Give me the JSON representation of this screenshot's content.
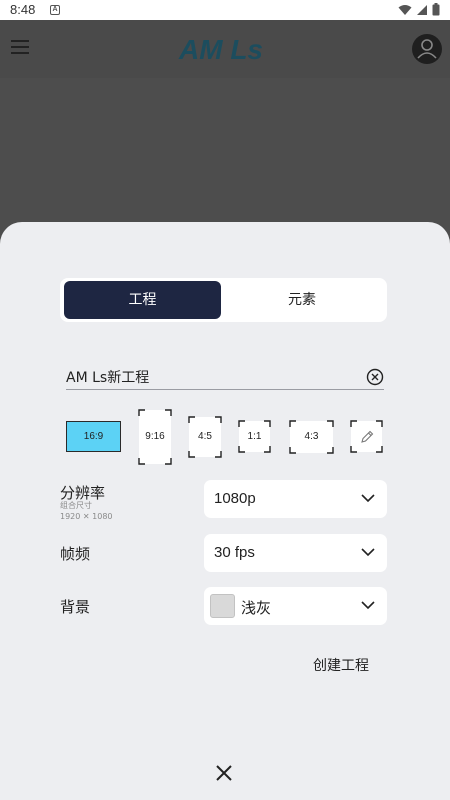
{
  "status_bar": {
    "time": "8:48",
    "notification_letter": "A"
  },
  "app_bar": {
    "logo_text": "AM Ls"
  },
  "tabs": [
    {
      "label": "工程",
      "active": true
    },
    {
      "label": "元素",
      "active": false
    }
  ],
  "project": {
    "name_value": "AM Ls新工程"
  },
  "aspect_ratios": [
    {
      "label": "16:9",
      "selected": true
    },
    {
      "label": "9:16",
      "selected": false
    },
    {
      "label": "4:5",
      "selected": false
    },
    {
      "label": "1:1",
      "selected": false
    },
    {
      "label": "4:3",
      "selected": false
    },
    {
      "label": "",
      "icon": "pencil-icon",
      "selected": false
    }
  ],
  "settings": {
    "resolution_label": "分辨率",
    "resolution_sub1": "组合尺寸",
    "resolution_sub2": "1920 ✕ 1080",
    "resolution_value": "1080p",
    "fps_label": "帧频",
    "fps_value": "30 fps",
    "background_label": "背景",
    "background_value": "浅灰",
    "background_color": "#d9d9d9"
  },
  "actions": {
    "create_label": "创建工程"
  },
  "colors": {
    "accent": "#5cd2f5",
    "tab_active": "#1e2642",
    "sheet_bg": "#edeef1"
  }
}
